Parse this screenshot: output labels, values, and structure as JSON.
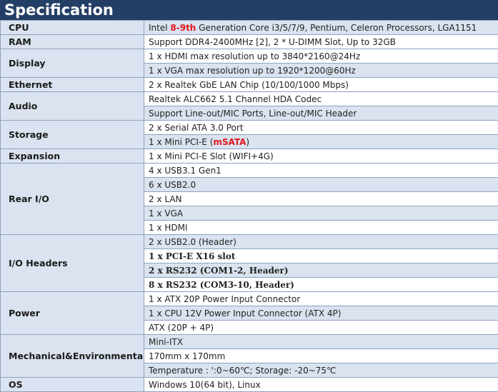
{
  "title": "Specification",
  "cpu": {
    "label": "CPU",
    "prefix": "Intel ",
    "highlight": "8-9th",
    "suffix": " Generation Core i3/5/7/9, Pentium, Celeron Processors, LGA1151"
  },
  "ram": {
    "label": "RAM",
    "value": "Support DDR4-2400MHz [2], 2 * U-DIMM Slot, Up to 32GB"
  },
  "display": {
    "label": "Display",
    "values": [
      "1 x HDMI max resolution up to 3840*2160@24Hz",
      "1 x VGA max resolution up to 1920*1200@60Hz"
    ]
  },
  "ethernet": {
    "label": "Ethernet",
    "value": "2 x Realtek GbE LAN Chip (10/100/1000 Mbps)"
  },
  "audio": {
    "label": "Audio",
    "values": [
      "Realtek ALC662 5.1 Channel HDA Codec",
      "Support Line-out/MIC Ports, Line-out/MIC Header"
    ]
  },
  "storage": {
    "label": "Storage",
    "value1": "2 x Serial ATA 3.0 Port",
    "value2_prefix": "1 x Mini PCI-E (",
    "value2_highlight": "mSATA",
    "value2_suffix": ")"
  },
  "expansion": {
    "label": "Expansion",
    "value": "1 x Mini PCI-E Slot (WIFI+4G)"
  },
  "rear_io": {
    "label": "Rear I/O",
    "values": [
      "4 x USB3.1 Gen1",
      "6 x USB2.0",
      "2 x LAN",
      "1 x VGA",
      "1 x HDMI"
    ]
  },
  "io_headers": {
    "label": "I/O Headers",
    "values": [
      "2 x USB2.0 (Header)",
      "1 x PCI-E X16 slot",
      "2 x RS232 (COM1-2, Header)",
      "8 x RS232 (COM3-10, Header)"
    ]
  },
  "power": {
    "label": "Power",
    "values": [
      "1 x ATX 20P Power Input Connector",
      "1 x CPU 12V Power Input Connector (ATX 4P)",
      "ATX (20P + 4P)"
    ]
  },
  "mechanical": {
    "label": "Mechanical&Environmental",
    "values": [
      "Mini-ITX",
      "170mm x 170mm",
      "Temperature : ':0~60℃; Storage: -20~75℃"
    ]
  },
  "os": {
    "label": "OS",
    "value": "Windows 10(64 bit), Linux"
  },
  "colors": {
    "header_bg": "#243f66",
    "label_bg": "#dae3ef",
    "highlight": "#e0161b",
    "border": "#8da2bf"
  }
}
